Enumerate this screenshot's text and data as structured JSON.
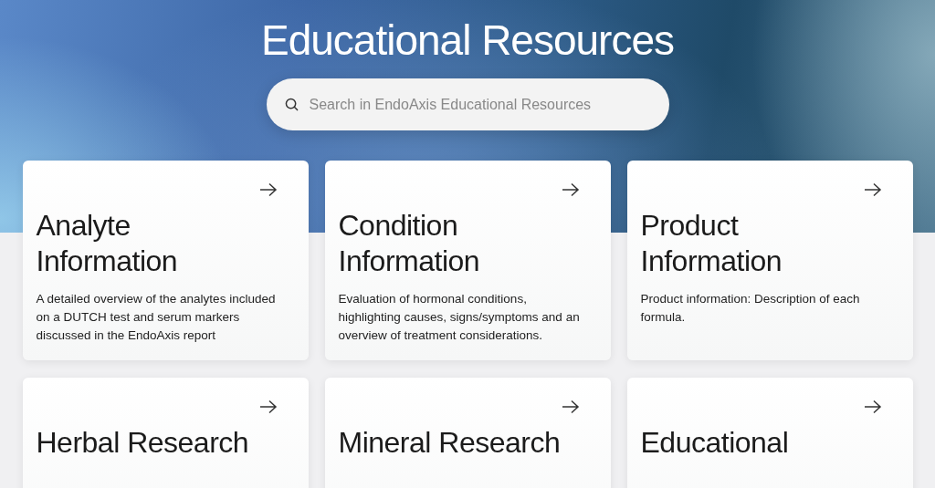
{
  "header": {
    "title": "Educational Resources"
  },
  "search": {
    "placeholder": "Search in EndoAxis Educational Resources"
  },
  "cards": [
    {
      "title": "Analyte Information",
      "description": "A detailed overview of the analytes included on a DUTCH test and serum markers discussed in the EndoAxis report"
    },
    {
      "title": "Condition Information",
      "description": "Evaluation of hormonal conditions, highlighting causes, signs/symptoms and an overview of treatment considerations."
    },
    {
      "title": "Product Information",
      "description": "Product information: Description of each formula."
    },
    {
      "title": "Herbal Research"
    },
    {
      "title": "Mineral Research"
    },
    {
      "title": "Educational"
    }
  ]
}
